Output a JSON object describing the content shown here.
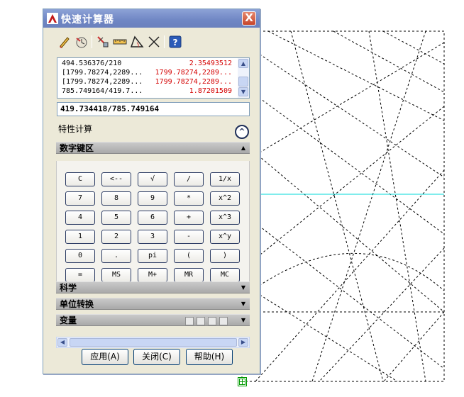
{
  "window": {
    "title": "快速计算器",
    "close_label": "X"
  },
  "toolbar": {
    "icons": [
      "clear-icon",
      "clear-history-icon",
      "get-coordinates-icon",
      "distance-icon",
      "angle-icon",
      "intersection-icon",
      "help-icon"
    ]
  },
  "history": {
    "rows": [
      {
        "expr": "494.536376/210",
        "result": "2.35493512"
      },
      {
        "expr": "[1799.78274,2289...",
        "result": "1799.78274,2289..."
      },
      {
        "expr": "[1799.78274,2289...",
        "result": "1799.78274,2289..."
      },
      {
        "expr": "785.749164/419.7...",
        "result": "1.87201509"
      }
    ]
  },
  "input": {
    "value": "419.734418/785.749164"
  },
  "properties": {
    "label": "特性计算",
    "expand_glyph": "^"
  },
  "sections": {
    "numpad": "数字键区",
    "science": "科学",
    "units": "单位转换",
    "variables": "变量"
  },
  "keypad": {
    "rows": [
      [
        "C",
        "<--",
        "√",
        "/",
        "1/x"
      ],
      [
        "7",
        "8",
        "9",
        "*",
        "x^2"
      ],
      [
        "4",
        "5",
        "6",
        "+",
        "x^3"
      ],
      [
        "1",
        "2",
        "3",
        "-",
        "x^y"
      ],
      [
        "0",
        ".",
        "pi",
        "(",
        ")"
      ],
      [
        "=",
        "MS",
        "M+",
        "MR",
        "MC"
      ]
    ]
  },
  "buttons": {
    "apply": "应用(A)",
    "close": "关闭(C)",
    "help": "帮助(H)"
  },
  "colors": {
    "title_bar": "#6f86c4",
    "result_text": "#d40000",
    "crosshair": "#00d8d8",
    "grip": "#009900"
  }
}
